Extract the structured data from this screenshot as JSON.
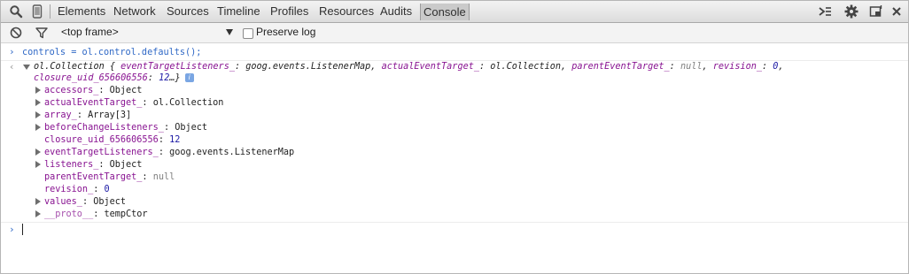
{
  "toolbar": {
    "tabs": [
      "Elements",
      "Network",
      "Sources",
      "Timeline",
      "Profiles",
      "Resources",
      "Audits",
      "Console"
    ],
    "selected_tab": "Console",
    "icons": [
      "search-icon",
      "device-mode-icon",
      "drawer-icon",
      "settings-gear-icon",
      "dock-icon",
      "close-icon"
    ]
  },
  "console_toolbar": {
    "frame_value": "<top frame>",
    "preserve_log_label": "Preserve log",
    "preserve_log_checked": false
  },
  "console": {
    "command": "controls = ol.control.defaults();",
    "summary": {
      "type": "ol.Collection {",
      "p1k": "eventTargetListeners_",
      "p1v": ": goog.events.ListenerMap, ",
      "p2k": "actualEventTarget_",
      "p2v": ": ol.Collection, ",
      "p3k": "parentEventTarget_",
      "p3v": ": ",
      "p3val": "null",
      "sep": ", ",
      "p4k": "revision_",
      "p4v": ": ",
      "p4val": "0",
      "comma": ",",
      "p5k": "closure_uid_656606556",
      "p5v": ": ",
      "p5val": "12",
      "ell": "…}",
      "info": "i"
    },
    "props": [
      {
        "key": "accessors_",
        "sep": ": ",
        "value": "Object",
        "expandable": true
      },
      {
        "key": "actualEventTarget_",
        "sep": ": ",
        "value": "ol.Collection",
        "expandable": true
      },
      {
        "key": "array_",
        "sep": ": ",
        "value": "Array[3]",
        "expandable": true
      },
      {
        "key": "beforeChangeListeners_",
        "sep": ": ",
        "value": "Object",
        "expandable": true
      },
      {
        "key": "closure_uid_656606556",
        "sep": ": ",
        "value": "12",
        "expandable": false
      },
      {
        "key": "eventTargetListeners_",
        "sep": ": ",
        "value": "goog.events.ListenerMap",
        "expandable": true
      },
      {
        "key": "listeners_",
        "sep": ": ",
        "value": "Object",
        "expandable": true
      },
      {
        "key": "parentEventTarget_",
        "sep": ": ",
        "value": "null",
        "expandable": false
      },
      {
        "key": "revision_",
        "sep": ": ",
        "value": "0",
        "expandable": false
      },
      {
        "key": "values_",
        "sep": ": ",
        "value": "Object",
        "expandable": true
      },
      {
        "key": "__proto__",
        "sep": ": ",
        "value": "tempCtor",
        "expandable": true
      }
    ]
  }
}
